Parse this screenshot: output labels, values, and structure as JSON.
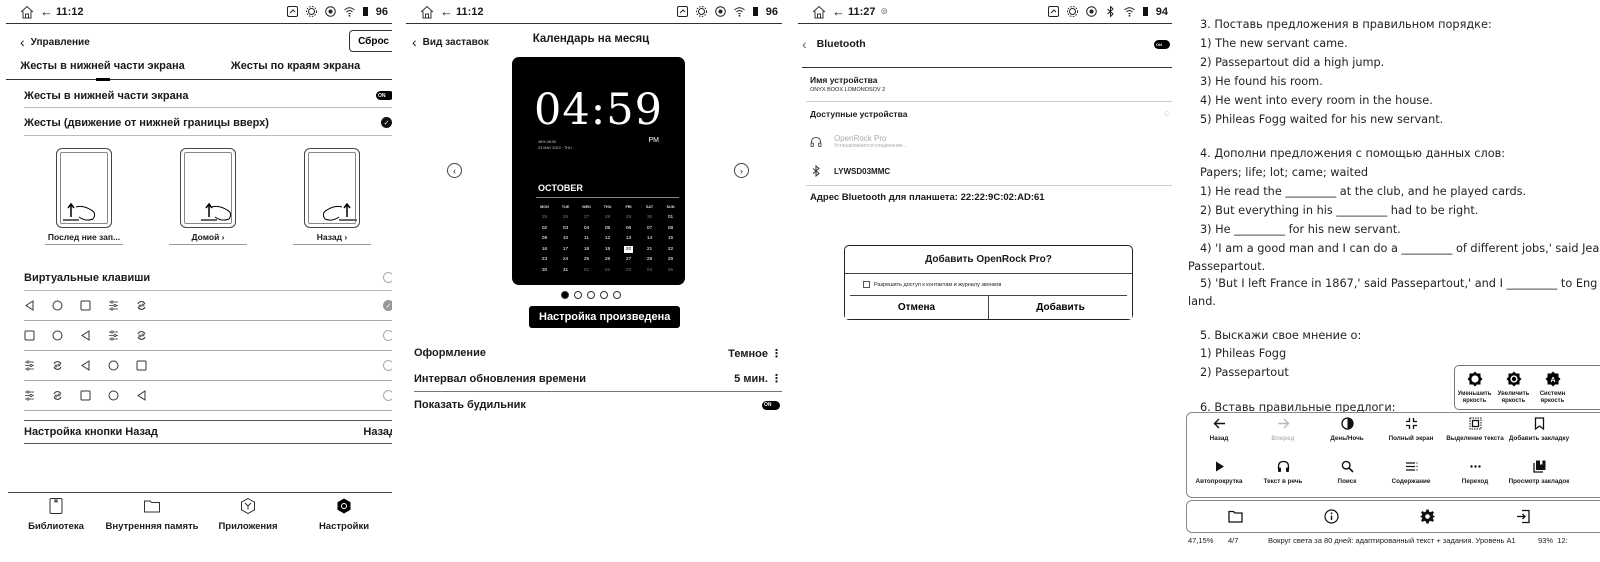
{
  "panel1": {
    "status": {
      "time": "11:12",
      "battery": "96"
    },
    "header": {
      "back_label": "Управление",
      "reset_label": "Сброс"
    },
    "tabs": [
      {
        "label": "Жесты в нижней части экрана",
        "active": true
      },
      {
        "label": "Жесты по краям экрана",
        "active": false
      }
    ],
    "toggle_row": {
      "label": "Жесты в нижней части экрана",
      "state": "ON"
    },
    "check_row": {
      "label": "Жесты (движение от нижней границы вверх)",
      "checked": true
    },
    "gestures": [
      {
        "label": "Послед ние зап...",
        "zone": "left"
      },
      {
        "label": "Домой",
        "zone": "center"
      },
      {
        "label": "Назад",
        "zone": "right"
      }
    ],
    "virtual_keys": {
      "label": "Виртуальные клавиши",
      "enabled": false,
      "layouts": [
        {
          "keys": [
            "back-triangle",
            "home-circle",
            "recent-square",
            "sliders",
            "refresh"
          ],
          "selected": true
        },
        {
          "keys": [
            "recent-square",
            "home-circle",
            "back-triangle",
            "sliders",
            "refresh"
          ],
          "selected": false
        },
        {
          "keys": [
            "sliders",
            "refresh",
            "back-triangle",
            "home-circle",
            "recent-square"
          ],
          "selected": false
        },
        {
          "keys": [
            "sliders",
            "refresh",
            "recent-square",
            "home-circle",
            "back-triangle"
          ],
          "selected": false
        }
      ]
    },
    "back_button_setting": {
      "label": "Настройка кнопки Назад",
      "value": "Назад"
    },
    "bottom_nav": [
      {
        "label": "Библиотека",
        "icon": "library-icon",
        "active": false
      },
      {
        "label": "Внутренняя память",
        "icon": "folder-icon",
        "active": false
      },
      {
        "label": "Приложения",
        "icon": "apps-icon",
        "active": false
      },
      {
        "label": "Настройки",
        "icon": "settings-icon",
        "active": true
      }
    ]
  },
  "panel2": {
    "status": {
      "time": "11:12",
      "battery": "96"
    },
    "header": {
      "back_label": "Вид заставок",
      "title": "Календарь на месяц"
    },
    "clock": {
      "time": "04:59",
      "ampm": "PM",
      "info_line": "48%   08:30",
      "date_line": "23 MAY 2023 · THU",
      "month": "OCTOBER",
      "weekdays": [
        "MON",
        "TUE",
        "WED",
        "THU",
        "FRI",
        "SAT",
        "SUN"
      ],
      "weeks": [
        [
          "25",
          "26",
          "27",
          "28",
          "29",
          "30",
          "01"
        ],
        [
          "02",
          "03",
          "04",
          "05",
          "06",
          "07",
          "08"
        ],
        [
          "09",
          "10",
          "11",
          "12",
          "13",
          "14",
          "15"
        ],
        [
          "16",
          "17",
          "18",
          "19",
          "20",
          "21",
          "22"
        ],
        [
          "23",
          "24",
          "25",
          "26",
          "27",
          "28",
          "29"
        ],
        [
          "30",
          "31",
          "01",
          "02",
          "03",
          "04",
          "05"
        ]
      ],
      "highlighted": "20"
    },
    "pager": {
      "count": 5,
      "active": 0
    },
    "toast": "Настройка произведена",
    "settings": [
      {
        "label": "Оформление",
        "value": "Темное"
      },
      {
        "label": "Интервал обновления времени",
        "value": "5 мин."
      },
      {
        "label": "Показать будильник",
        "value": "ON"
      }
    ]
  },
  "panel3": {
    "status": {
      "time": "11:27",
      "battery": "94"
    },
    "header": {
      "title": "Bluetooth",
      "state": "ON"
    },
    "device_name": {
      "label": "Имя устройства",
      "value": "ONYX BOOX LOMONOSOV 2"
    },
    "available_label": "Доступные устройства",
    "devices": [
      {
        "name": "OpenRock Pro",
        "status": "Устанавливается соединение...",
        "icon": "headphones-icon"
      },
      {
        "name": "LYWSD03MMC",
        "status": "",
        "icon": "bluetooth-icon"
      }
    ],
    "address": "Адрес Bluetooth для планшета: 22:22:9C:02:AD:61",
    "dialog": {
      "title": "Добавить OpenRock Pro?",
      "checkbox_label": "Разрешить доступ к контактам и журналу звонков",
      "checked": false,
      "cancel": "Отмена",
      "confirm": "Добавить"
    }
  },
  "panel4": {
    "text_lines": [
      "3. Поставь предложения в правильном порядке:",
      "1) The new servant came.",
      "2) Passepartout did a high jump.",
      "3) He found his room.",
      "4) He went into every room in the house.",
      "5) Phileas Fogg waited for his new servant.",
      "4. Дополни предложения с помощью данных слов:",
      "Papers; life; lot; came; waited",
      "1) He read the _________ at the club, and he played cards.",
      "2) But everything in his _________ had to be right.",
      "3) He _________ for his new servant.",
      "4)  'I am a good man and I can do a _________ of different jobs,' said Jea",
      "Passepartout.",
      "5)  'But I left France in 1867,' said Passepartout,' and I _________ to Eng",
      "land.",
      "5. Выскажи свое мнение о:",
      "1) Phileas Fogg",
      "2) Passepartout",
      "6. Вставь правильные предлоги:"
    ],
    "brightness": [
      {
        "label": "Уменьшить яркость",
        "icon": "brightness-down-icon"
      },
      {
        "label": "Увеличить яркость",
        "icon": "brightness-up-icon"
      },
      {
        "label": "Системн яркость",
        "icon": "brightness-auto-icon"
      }
    ],
    "menu_rows": [
      [
        {
          "label": "Назад",
          "icon": "arrow-left-icon",
          "disabled": false
        },
        {
          "label": "Вперед",
          "icon": "arrow-right-icon",
          "disabled": true
        },
        {
          "label": "День/Ночь",
          "icon": "contrast-icon",
          "disabled": false
        },
        {
          "label": "Полный экран",
          "icon": "fullscreen-exit-icon",
          "disabled": false
        },
        {
          "label": "Выделение текста",
          "icon": "select-text-icon",
          "disabled": false
        },
        {
          "label": "Добавить закладку",
          "icon": "bookmark-icon",
          "disabled": false
        }
      ],
      [
        {
          "label": "Автопрокрутка",
          "icon": "play-icon",
          "disabled": false
        },
        {
          "label": "Текст в речь",
          "icon": "headphones-icon",
          "disabled": false
        },
        {
          "label": "Поиск",
          "icon": "search-icon",
          "disabled": false
        },
        {
          "label": "Содержание",
          "icon": "toc-icon",
          "disabled": false
        },
        {
          "label": "Переход",
          "icon": "more-icon",
          "disabled": false
        },
        {
          "label": "Просмотр закладок",
          "icon": "bookmarks-icon",
          "disabled": false
        }
      ]
    ],
    "bottom_bar": [
      "folder-icon",
      "info-icon",
      "settings-icon",
      "exit-icon"
    ],
    "footer": {
      "progress": "47,15%",
      "page": "4/7",
      "title": "Вокруг света за 80 дней: адаптированный текст + задания. Уровень А1",
      "battery": "93%",
      "time": "12:"
    }
  }
}
